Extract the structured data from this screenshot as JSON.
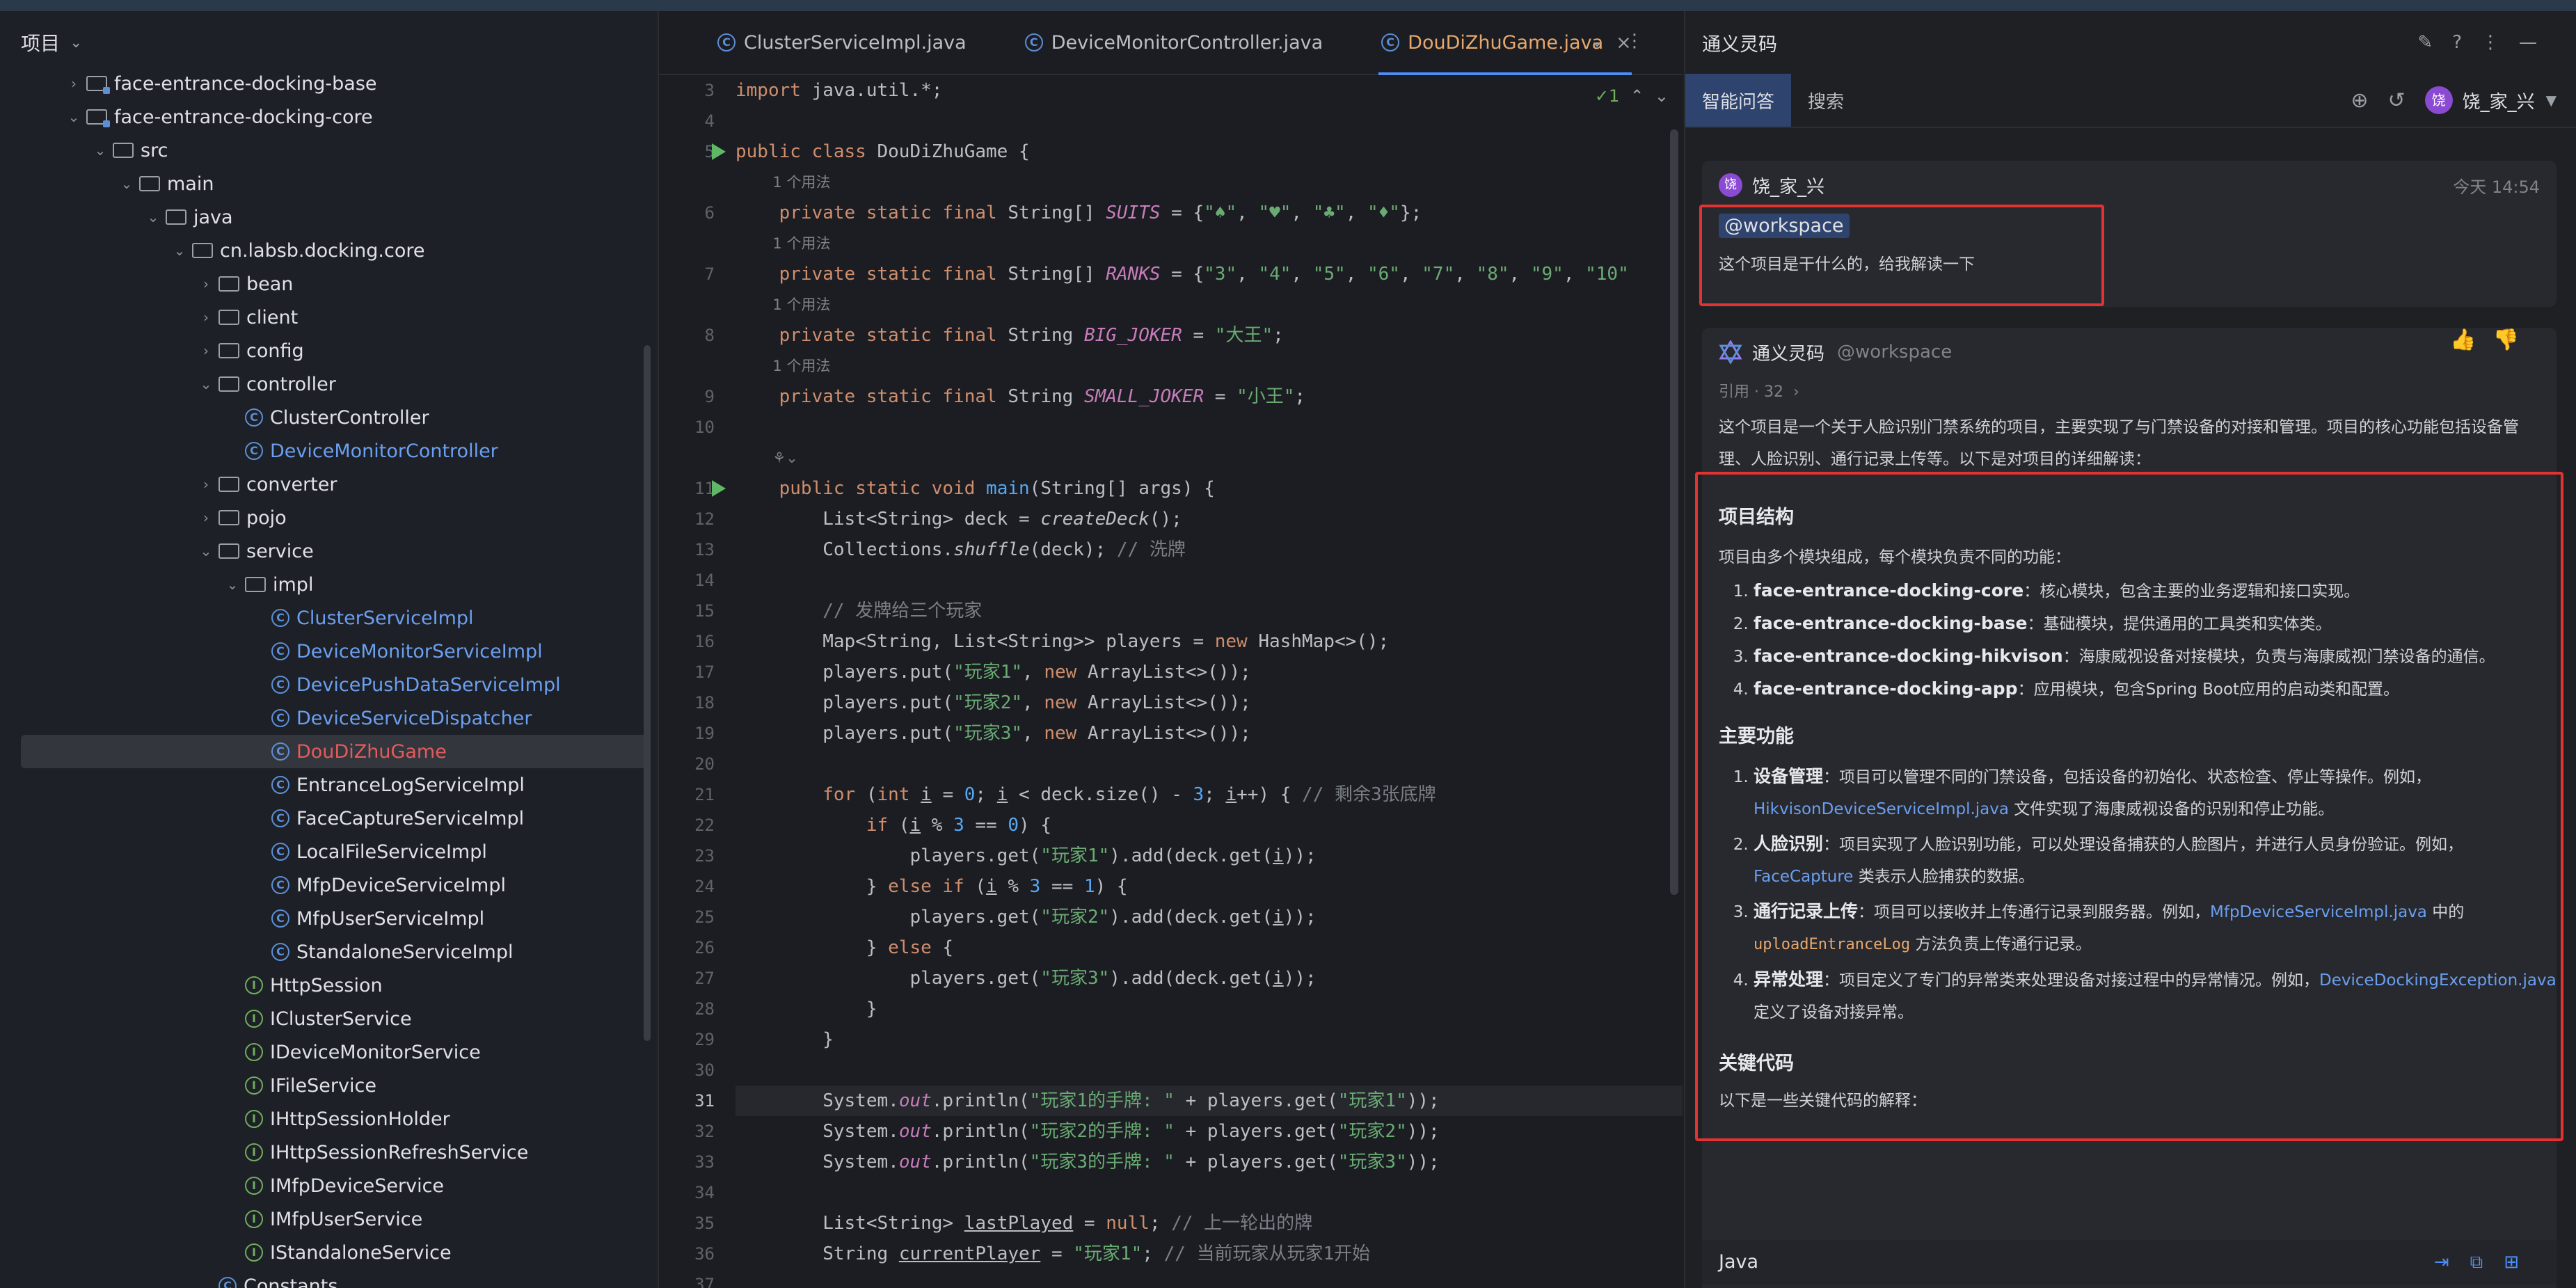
{
  "project": {
    "title": "项目",
    "items": [
      {
        "label": "face-entrance-docking-base",
        "depth": 1,
        "kind": "module",
        "arrow": "›"
      },
      {
        "label": "face-entrance-docking-core",
        "depth": 1,
        "kind": "module",
        "arrow": "⌄"
      },
      {
        "label": "src",
        "depth": 2,
        "kind": "folder",
        "arrow": "⌄"
      },
      {
        "label": "main",
        "depth": 3,
        "kind": "folder",
        "arrow": "⌄"
      },
      {
        "label": "java",
        "depth": 4,
        "kind": "folder",
        "arrow": "⌄"
      },
      {
        "label": "cn.labsb.docking.core",
        "depth": 5,
        "kind": "folder",
        "arrow": "⌄"
      },
      {
        "label": "bean",
        "depth": 6,
        "kind": "folder",
        "arrow": "›"
      },
      {
        "label": "client",
        "depth": 6,
        "kind": "folder",
        "arrow": "›"
      },
      {
        "label": "config",
        "depth": 6,
        "kind": "folder",
        "arrow": "›"
      },
      {
        "label": "controller",
        "depth": 6,
        "kind": "folder",
        "arrow": "⌄"
      },
      {
        "label": "ClusterController",
        "depth": 7,
        "kind": "class",
        "color": "normal"
      },
      {
        "label": "DeviceMonitorController",
        "depth": 7,
        "kind": "class",
        "color": "blue"
      },
      {
        "label": "converter",
        "depth": 6,
        "kind": "folder",
        "arrow": "›"
      },
      {
        "label": "pojo",
        "depth": 6,
        "kind": "folder",
        "arrow": "›"
      },
      {
        "label": "service",
        "depth": 6,
        "kind": "folder",
        "arrow": "⌄"
      },
      {
        "label": "impl",
        "depth": 7,
        "kind": "folder",
        "arrow": "⌄"
      },
      {
        "label": "ClusterServiceImpl",
        "depth": 8,
        "kind": "class",
        "color": "blue"
      },
      {
        "label": "DeviceMonitorServiceImpl",
        "depth": 8,
        "kind": "class",
        "color": "blue"
      },
      {
        "label": "DevicePushDataServiceImpl",
        "depth": 8,
        "kind": "class",
        "color": "blue"
      },
      {
        "label": "DeviceServiceDispatcher",
        "depth": 8,
        "kind": "class",
        "color": "blue"
      },
      {
        "label": "DouDiZhuGame",
        "depth": 8,
        "kind": "class",
        "color": "red",
        "selected": true
      },
      {
        "label": "EntranceLogServiceImpl",
        "depth": 8,
        "kind": "class",
        "color": "normal"
      },
      {
        "label": "FaceCaptureServiceImpl",
        "depth": 8,
        "kind": "class",
        "color": "normal"
      },
      {
        "label": "LocalFileServiceImpl",
        "depth": 8,
        "kind": "class",
        "color": "normal"
      },
      {
        "label": "MfpDeviceServiceImpl",
        "depth": 8,
        "kind": "class",
        "color": "normal"
      },
      {
        "label": "MfpUserServiceImpl",
        "depth": 8,
        "kind": "class",
        "color": "normal"
      },
      {
        "label": "StandaloneServiceImpl",
        "depth": 8,
        "kind": "class",
        "color": "normal"
      },
      {
        "label": "HttpSession",
        "depth": 7,
        "kind": "interface",
        "color": "normal"
      },
      {
        "label": "IClusterService",
        "depth": 7,
        "kind": "interface",
        "color": "normal"
      },
      {
        "label": "IDeviceMonitorService",
        "depth": 7,
        "kind": "interface",
        "color": "normal"
      },
      {
        "label": "IFileService",
        "depth": 7,
        "kind": "interface",
        "color": "normal"
      },
      {
        "label": "IHttpSessionHolder",
        "depth": 7,
        "kind": "interface",
        "color": "normal"
      },
      {
        "label": "IHttpSessionRefreshService",
        "depth": 7,
        "kind": "interface",
        "color": "normal"
      },
      {
        "label": "IMfpDeviceService",
        "depth": 7,
        "kind": "interface",
        "color": "normal"
      },
      {
        "label": "IMfpUserService",
        "depth": 7,
        "kind": "interface",
        "color": "normal"
      },
      {
        "label": "IStandaloneService",
        "depth": 7,
        "kind": "interface",
        "color": "normal"
      },
      {
        "label": "Constants",
        "depth": 6,
        "kind": "class",
        "color": "normal"
      }
    ]
  },
  "editor": {
    "tabs": [
      {
        "label": "ClusterServiceImpl.java",
        "active": false
      },
      {
        "label": "DeviceMonitorController.java",
        "active": false
      },
      {
        "label": "DouDiZhuGame.java",
        "active": true
      }
    ],
    "inspection": "✓1",
    "usage_hint": "1 个用法",
    "lines": [
      {
        "n": "3",
        "html": "<span class=\"kw\">import</span> java.util.*;"
      },
      {
        "n": "4",
        "html": ""
      },
      {
        "n": "5",
        "run": true,
        "html": "<span class=\"kw\">public class</span> DouDiZhuGame {"
      },
      {
        "hint": "1 个用法",
        "indent": "    "
      },
      {
        "n": "6",
        "html": "    <span class=\"kw\">private static final</span> String[] <span class=\"it\">SUITS</span> = {<span class=\"str\">\"♠\"</span>, <span class=\"str\">\"♥\"</span>, <span class=\"str\">\"♣\"</span>, <span class=\"str\">\"♦\"</span>};"
      },
      {
        "hint": "1 个用法",
        "indent": "    "
      },
      {
        "n": "7",
        "html": "    <span class=\"kw\">private static final</span> String[] <span class=\"it\">RANKS</span> = {<span class=\"str\">\"3\"</span>, <span class=\"str\">\"4\"</span>, <span class=\"str\">\"5\"</span>, <span class=\"str\">\"6\"</span>, <span class=\"str\">\"7\"</span>, <span class=\"str\">\"8\"</span>, <span class=\"str\">\"9\"</span>, <span class=\"str\">\"10\"</span>"
      },
      {
        "hint": "1 个用法",
        "indent": "    "
      },
      {
        "n": "8",
        "html": "    <span class=\"kw\">private static final</span> String <span class=\"it\">BIG_JOKER</span> = <span class=\"str\">\"大王\"</span>;"
      },
      {
        "hint": "1 个用法",
        "indent": "    "
      },
      {
        "n": "9",
        "html": "    <span class=\"kw\">private static final</span> String <span class=\"it\">SMALL_JOKER</span> = <span class=\"str\">\"小王\"</span>;"
      },
      {
        "n": "10",
        "html": ""
      },
      {
        "hint": "⚘⌄",
        "indent": "    "
      },
      {
        "n": "11",
        "run": true,
        "html": "    <span class=\"kw\">public static void</span> <span class=\"fn\">main</span>(String[] args) {"
      },
      {
        "n": "12",
        "html": "        List&lt;String&gt; deck = <span class=\"sty\">createDeck</span>();"
      },
      {
        "n": "13",
        "html": "        Collections.<span class=\"sty\">shuffle</span>(deck); <span class=\"cm\">// 洗牌</span>"
      },
      {
        "n": "14",
        "html": ""
      },
      {
        "n": "15",
        "html": "        <span class=\"cm\">// 发牌给三个玩家</span>"
      },
      {
        "n": "16",
        "html": "        Map&lt;String, List&lt;String&gt;&gt; players = <span class=\"kw\">new</span> HashMap&lt;&gt;();"
      },
      {
        "n": "17",
        "html": "        players.put(<span class=\"str\">\"玩家1\"</span>, <span class=\"kw\">new</span> ArrayList&lt;&gt;());"
      },
      {
        "n": "18",
        "html": "        players.put(<span class=\"str\">\"玩家2\"</span>, <span class=\"kw\">new</span> ArrayList&lt;&gt;());"
      },
      {
        "n": "19",
        "html": "        players.put(<span class=\"str\">\"玩家3\"</span>, <span class=\"kw\">new</span> ArrayList&lt;&gt;());"
      },
      {
        "n": "20",
        "html": ""
      },
      {
        "n": "21",
        "html": "        <span class=\"kw\">for</span> (<span class=\"kw\">int</span> <u>i</u> = <span class=\"fn\">0</span>; <u>i</u> &lt; deck.size() - <span class=\"fn\">3</span>; <u>i</u>++) { <span class=\"cm\">// 剩余3张底牌</span>"
      },
      {
        "n": "22",
        "html": "            <span class=\"kw\">if</span> (<u>i</u> % <span class=\"fn\">3</span> == <span class=\"fn\">0</span>) {"
      },
      {
        "n": "23",
        "html": "                players.get(<span class=\"str\">\"玩家1\"</span>).add(deck.get(<u>i</u>));"
      },
      {
        "n": "24",
        "html": "            } <span class=\"kw\">else if</span> (<u>i</u> % <span class=\"fn\">3</span> == <span class=\"fn\">1</span>) {"
      },
      {
        "n": "25",
        "html": "                players.get(<span class=\"str\">\"玩家2\"</span>).add(deck.get(<u>i</u>));"
      },
      {
        "n": "26",
        "html": "            } <span class=\"kw\">else</span> {"
      },
      {
        "n": "27",
        "html": "                players.get(<span class=\"str\">\"玩家3\"</span>).add(deck.get(<u>i</u>));"
      },
      {
        "n": "28",
        "html": "            }"
      },
      {
        "n": "29",
        "html": "        }"
      },
      {
        "n": "30",
        "html": ""
      },
      {
        "n": "31",
        "cur": true,
        "html": "        System.<span class=\"it\">out</span>.println(<span class=\"str\">\"玩家1的手牌: \"</span> + players.get(<span class=\"str\">\"玩家1\"</span>));"
      },
      {
        "n": "32",
        "html": "        System.<span class=\"it\">out</span>.println(<span class=\"str\">\"玩家2的手牌: \"</span> + players.get(<span class=\"str\">\"玩家2\"</span>));"
      },
      {
        "n": "33",
        "html": "        System.<span class=\"it\">out</span>.println(<span class=\"str\">\"玩家3的手牌: \"</span> + players.get(<span class=\"str\">\"玩家3\"</span>));"
      },
      {
        "n": "34",
        "html": ""
      },
      {
        "n": "35",
        "html": "        List&lt;String&gt; <u>lastPlayed</u> = <span class=\"kw\">null</span>; <span class=\"cm\">// 上一轮出的牌</span>"
      },
      {
        "n": "36",
        "html": "        String <u>currentPlayer</u> = <span class=\"str\">\"玩家1\"</span>; <span class=\"cm\">// 当前玩家从玩家1开始</span>"
      },
      {
        "n": "37",
        "html": ""
      }
    ]
  },
  "ai": {
    "title": "通义灵码",
    "tabs": [
      "智能问答",
      "搜索"
    ],
    "user_name": "饶_家_兴",
    "avatar_char": "饶",
    "user_msg": {
      "name": "饶_家_兴",
      "time": "今天 14:54",
      "mention": "@workspace",
      "text": "这个项目是干什么的，给我解读一下"
    },
    "reply": {
      "name": "通义灵码",
      "mention": "@workspace",
      "refs": "引用 · 32",
      "intro": "这个项目是一个关于人脸识别门禁系统的项目，主要实现了与门禁设备的对接和管理。项目的核心功能包括设备管理、人脸识别、通行记录上传等。以下是对项目的详细解读：",
      "h_structure": "项目结构",
      "structure_intro": "项目由多个模块组成，每个模块负责不同的功能：",
      "modules": [
        {
          "name": "face-entrance-docking-core",
          "desc": "：核心模块，包含主要的业务逻辑和接口实现。"
        },
        {
          "name": "face-entrance-docking-base",
          "desc": "：基础模块，提供通用的工具类和实体类。"
        },
        {
          "name": "face-entrance-docking-hikvison",
          "desc": "：海康威视设备对接模块，负责与海康威视门禁设备的通信。"
        },
        {
          "name": "face-entrance-docking-app",
          "desc": "：应用模块，包含Spring Boot应用的启动类和配置。"
        }
      ],
      "h_features": "主要功能",
      "features": [
        {
          "name": "设备管理",
          "t1": "：项目可以管理不同的门禁设备，包括设备的初始化、状态检查、停止等操作。例如，",
          "link": "HikvisonDeviceServiceImpl.java",
          "t2": " 文件实现了海康威视设备的识别和停止功能。"
        },
        {
          "name": "人脸识别",
          "t1": "：项目实现了人脸识别功能，可以处理设备捕获的人脸图片，并进行人员身份验证。例如，",
          "link": "FaceCapture",
          "t2": " 类表示人脸捕获的数据。"
        },
        {
          "name": "通行记录上传",
          "t1": "：项目可以接收并上传通行记录到服务器。例如，",
          "link": "MfpDeviceServiceImpl.java",
          "t2": " 中的 ",
          "code": "uploadEntranceLog",
          "t3": " 方法负责上传通行记录。"
        },
        {
          "name": "异常处理",
          "t1": "：项目定义了专门的异常类来处理设备对接过程中的异常情况。例如，",
          "link": "DeviceDockingException.java",
          "t2": " 定义了设备对接异常。"
        }
      ],
      "h_code": "关键代码",
      "code_intro": "以下是一些关键代码的解释：",
      "code_lang": "Java"
    }
  }
}
